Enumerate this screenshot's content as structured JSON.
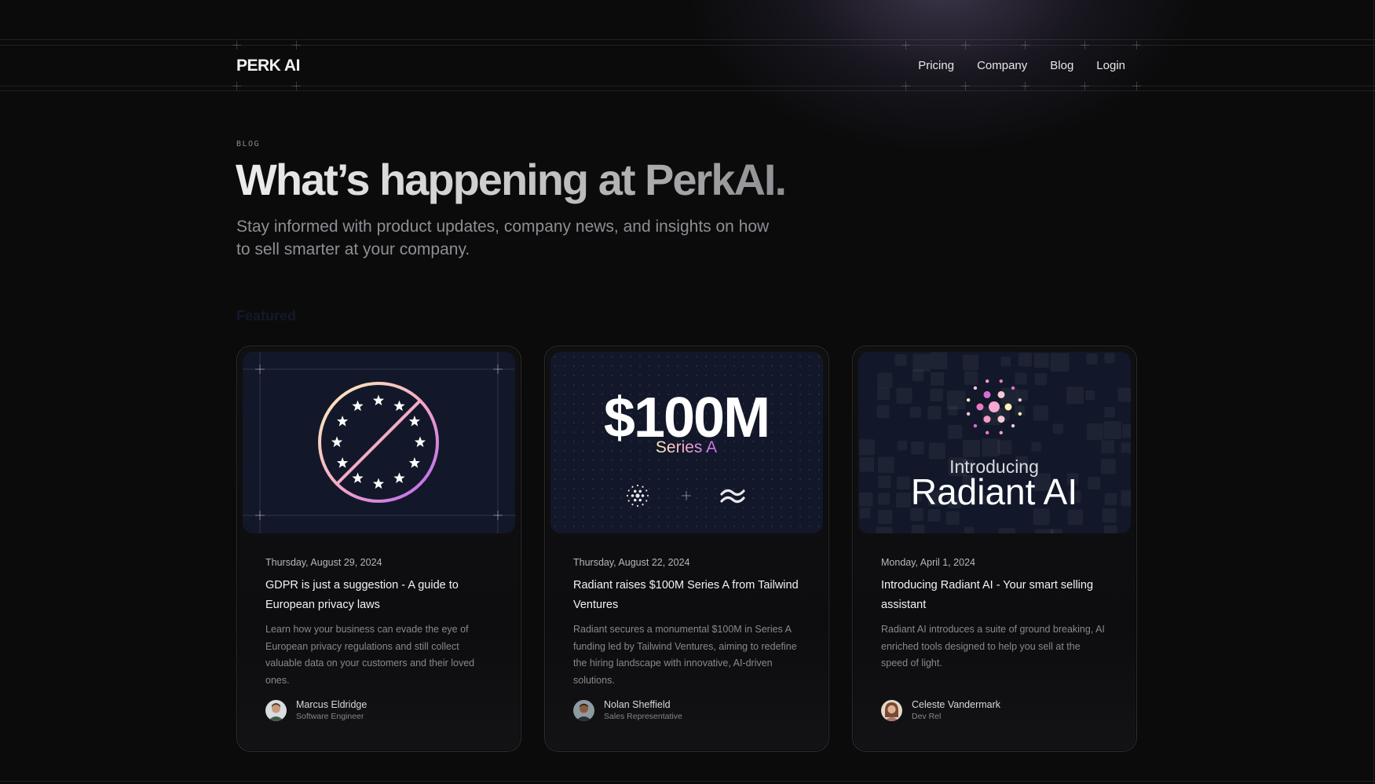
{
  "brand": "PERK AI",
  "nav": [
    "Pricing",
    "Company",
    "Blog",
    "Login"
  ],
  "hero": {
    "eyebrow": "BLOG",
    "title": "What’s happening at PerkAI.",
    "subtitle": "Stay informed with product updates, company news, and insights on how to sell smarter at your company."
  },
  "section_label": "Featured",
  "posts": [
    {
      "date": "Thursday, August 29, 2024",
      "title": "GDPR is just a suggestion - A guide to European privacy laws",
      "excerpt": "Learn how your business can evade the eye of European privacy regulations and still collect valuable data on your customers and their loved ones.",
      "author": "Marcus Eldridge",
      "role": "Software Engineer"
    },
    {
      "date": "Thursday, August 22, 2024",
      "title": "Radiant raises $100M Series A from Tailwind Ventures",
      "excerpt": "Radiant secures a monumental $100M in Series A funding led by Tailwind Ventures, aiming to redefine the hiring landscape with innovative, AI-driven solutions.",
      "author": "Nolan Sheffield",
      "role": "Sales Representative",
      "image_text": {
        "amount": "$100M",
        "round": "Series A"
      }
    },
    {
      "date": "Monday, April 1, 2024",
      "title": "Introducing Radiant AI - Your smart selling assistant",
      "excerpt": "Radiant AI introduces a suite of ground breaking, AI enriched tools designed to help you sell at the speed of light.",
      "author": "Celeste Vandermark",
      "role": "Dev Rel",
      "image_text": {
        "kicker": "Introducing",
        "name": "Radiant AI"
      }
    }
  ],
  "colors": {
    "background": "#0b0b0c",
    "card_image_bg": "#121829",
    "gradient_yellow": "#fff1be",
    "gradient_pink": "#ee87cb",
    "gradient_purple": "#b060ff"
  }
}
